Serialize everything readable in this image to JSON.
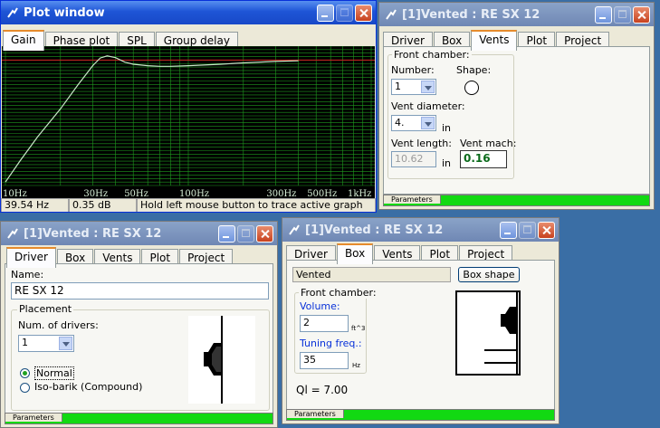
{
  "plot_window": {
    "title": "Plot window",
    "tabs": [
      "Gain",
      "Phase plot",
      "SPL",
      "Group delay"
    ],
    "x_tick_labels": [
      "10Hz",
      "30Hz",
      "50Hz",
      "100Hz",
      "300Hz",
      "500Hz",
      "1kHz"
    ],
    "status": {
      "freq": "39.54 Hz",
      "gain": "0.35 dB",
      "hint": "Hold left mouse button to trace active graph"
    },
    "colors": {
      "background": "#000000",
      "grid": "#1f9a1f",
      "curve": "#c8e8c8",
      "reference": "#d02020"
    }
  },
  "chart_data": {
    "type": "line",
    "xscale": "log",
    "xlim": [
      10,
      1000
    ],
    "x_tick_labels": [
      "10Hz",
      "30Hz",
      "50Hz",
      "100Hz",
      "300Hz",
      "500Hz",
      "1kHz"
    ],
    "series": [
      {
        "x": [
          10,
          12,
          15,
          20,
          25,
          30,
          33,
          36,
          40,
          45,
          50,
          60,
          70,
          80,
          100,
          150,
          200,
          300,
          400
        ],
        "y": [
          -17.5,
          -14.5,
          -11,
          -7,
          -3.5,
          -0.8,
          0.3,
          0.6,
          0.35,
          -0.3,
          -0.6,
          -0.8,
          -0.9,
          -0.9,
          -0.8,
          -0.6,
          -0.4,
          -0.2,
          -0.1
        ]
      }
    ],
    "reference_line": 0,
    "ylim": [
      -18,
      2
    ],
    "grid": true
  },
  "vents_window": {
    "title": "[1]Vented : RE SX 12",
    "tabs": [
      "Driver",
      "Box",
      "Vents",
      "Plot",
      "Project"
    ],
    "group_title": "Front chamber:",
    "number_label": "Number:",
    "number_value": "1",
    "shape_label": "Shape:",
    "diameter_label": "Vent diameter:",
    "diameter_value": "4.",
    "diameter_unit": "in",
    "length_label": "Vent length:",
    "length_value": "10.62",
    "length_unit": "in",
    "mach_label": "Vent mach:",
    "mach_value": "0.16",
    "params": "Parameters"
  },
  "driver_window": {
    "title": "[1]Vented : RE SX 12",
    "tabs": [
      "Driver",
      "Box",
      "Vents",
      "Plot",
      "Project"
    ],
    "name_label": "Name:",
    "name_value": "RE SX 12",
    "placement_title": "Placement",
    "num_drivers_label": "Num. of drivers:",
    "num_drivers_value": "1",
    "radio_normal": "Normal",
    "radio_isobarik": "Iso-barik (Compound)",
    "params": "Parameters"
  },
  "box_window": {
    "title": "[1]Vented : RE SX 12",
    "tabs": [
      "Driver",
      "Box",
      "Vents",
      "Plot",
      "Project"
    ],
    "type_value": "Vented",
    "shape_button": "Box shape",
    "group_title": "Front chamber:",
    "volume_label": "Volume:",
    "volume_value": "2",
    "volume_unit": "ft^3",
    "tuning_label": "Tuning freq.:",
    "tuning_value": "35",
    "tuning_unit": "Hz",
    "ql": "Ql = 7.00",
    "params": "Parameters"
  }
}
